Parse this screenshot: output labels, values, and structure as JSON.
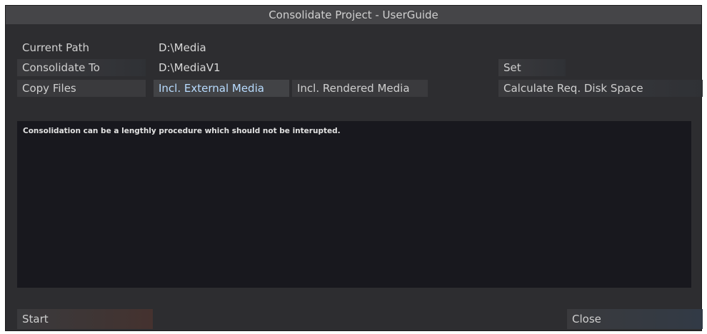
{
  "window": {
    "title": "Consolidate Project - UserGuide"
  },
  "rows": {
    "current_path": {
      "label": "Current Path",
      "value": "D:\\Media"
    },
    "consolidate_to": {
      "label": "Consolidate To",
      "value": "D:\\MediaV1",
      "set_label": "Set"
    },
    "copy_files": {
      "label": "Copy Files",
      "incl_external_label": "Incl. External Media",
      "incl_rendered_label": "Incl. Rendered Media",
      "calc_label": "Calculate Req. Disk Space"
    }
  },
  "log": {
    "message": "Consolidation can be a lengthly procedure which should not be interupted."
  },
  "footer": {
    "start_label": "Start",
    "close_label": "Close"
  }
}
